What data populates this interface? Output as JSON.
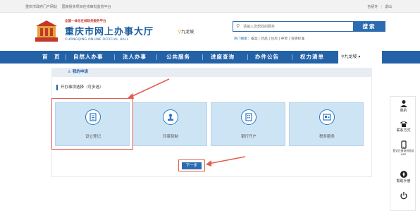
{
  "topbar": {
    "links": [
      "重庆市政府门户网站",
      "国家投资项目在线审批监管平台"
    ],
    "user": "吉绍冬",
    "logout": "退出"
  },
  "header": {
    "logo_small": "全国一体化在线政务服务平台",
    "logo_title": "重庆市网上办事大厅",
    "logo_en": "CHONGQING ONLINE OFFICIAL HALL",
    "location": "九龙坡",
    "search_placeholder": "请输入您想找的服务",
    "search_button": "搜索",
    "hot_label": "热门搜索：",
    "hot_terms": "备案 | 药品 | 住房 | 养老 | 资质标准"
  },
  "nav": {
    "items": [
      "首　页",
      "自然人办事",
      "法人办事",
      "公共服务",
      "进度查询",
      "办件公告",
      "权力清单"
    ],
    "region": "九龙坡"
  },
  "main": {
    "apply_title": "我的申请",
    "section_title": "开办事项选择（可多选）",
    "cards": [
      "设立登记",
      "印章刻制",
      "银行开户",
      "税务服务"
    ],
    "next_button": "下一步"
  },
  "sidebar": {
    "items": [
      "我的",
      "联系方式",
      "登记注册身份验证APP",
      "帮助手册"
    ]
  },
  "colors": {
    "nav_blue": "#2462a8",
    "card_bg": "#cde4f5",
    "highlight_red": "#e25d50"
  }
}
